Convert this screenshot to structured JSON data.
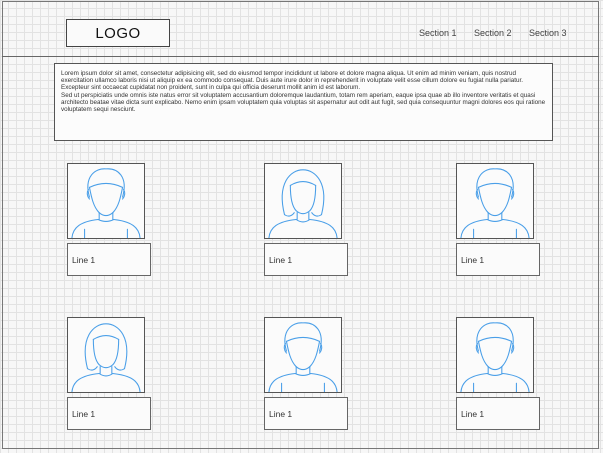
{
  "header": {
    "logo": "LOGO",
    "nav": [
      "Section 1",
      "Section 2",
      "Section 3"
    ]
  },
  "intro": {
    "paragraph1": "Lorem ipsum dolor sit amet, consectetur adipisicing elit, sed do eiusmod tempor incididunt ut labore et dolore magna aliqua. Ut enim ad minim veniam, quis nostrud exercitation ullamco laboris nisi ut aliquip ex ea commodo consequat. Duis aute irure dolor in reprehenderit in voluptate velit esse cillum dolore eu fugiat nulla pariatur. Excepteur sint occaecat cupidatat non proident, sunt in culpa qui officia deserunt mollit anim id est laborum.",
    "paragraph2": "Sed ut perspiciatis unde omnis iste natus error sit voluptatem accusantium doloremque laudantium, totam rem aperiam, eaque ipsa quae ab illo inventore veritatis et quasi architecto beatae vitae dicta sunt explicabo. Nemo enim ipsam voluptatem quia voluptas sit aspernatur aut odit aut fugit, sed quia consequuntur magni dolores eos qui ratione voluptatem sequi nesciunt."
  },
  "cards": [
    {
      "label": "Line 1",
      "avatar": "male-avatar-icon"
    },
    {
      "label": "Line 1",
      "avatar": "female-avatar-icon"
    },
    {
      "label": "Line 1",
      "avatar": "male-avatar-icon"
    },
    {
      "label": "Line 1",
      "avatar": "female-avatar-icon"
    },
    {
      "label": "Line 1",
      "avatar": "male-avatar-icon"
    },
    {
      "label": "Line 1",
      "avatar": "male-avatar-icon"
    }
  ],
  "colors": {
    "avatar_stroke": "#4a9fe8",
    "sketch_border": "#555555"
  }
}
